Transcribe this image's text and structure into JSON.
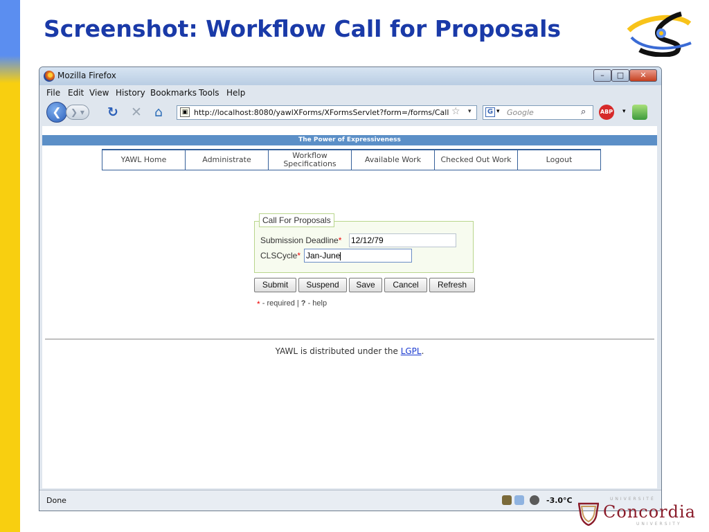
{
  "slide": {
    "title": "Screenshot: Workflow Call for Proposals"
  },
  "window": {
    "title": "Mozilla Firefox",
    "minimize": "–",
    "maximize": "□",
    "close": "✕"
  },
  "menu": [
    "File",
    "Edit",
    "View",
    "History",
    "Bookmarks",
    "Tools",
    "Help"
  ],
  "toolbar": {
    "url": "http://localhost:8080/yawlXForms/XFormsServlet?form=/forms/Call",
    "search_placeholder": "Google",
    "search_engine_letter": "G",
    "adblock_label": "ABP"
  },
  "page": {
    "banner": "The Power of Expressiveness",
    "nav": [
      {
        "label": "YAWL Home"
      },
      {
        "label": "Administrate"
      },
      {
        "label": "Workflow Specifications",
        "line1": "Workflow",
        "line2": "Specifications"
      },
      {
        "label": "Available Work"
      },
      {
        "label": "Checked Out Work"
      },
      {
        "label": "Logout"
      }
    ],
    "form": {
      "legend": "Call For Proposals",
      "fields": [
        {
          "label": "Submission Deadline",
          "required_mark": "*",
          "value": "12/12/79"
        },
        {
          "label": "CLSCycle",
          "required_mark": "*",
          "value": "Jan-June"
        }
      ],
      "buttons": [
        "Submit",
        "Suspend",
        "Save",
        "Cancel",
        "Refresh"
      ],
      "help": {
        "star": "*",
        "required_text": " - required | ",
        "question": "?",
        "help_text": " - help"
      }
    },
    "footer": {
      "prefix": "YAWL is distributed under the ",
      "link": "LGPL",
      "suffix": "."
    }
  },
  "status": {
    "text": "Done",
    "temperature": "-3.0°C"
  },
  "logo": {
    "top": "UNIVERSITÉ",
    "name": "Concordia",
    "bottom": "UNIVERSITY"
  },
  "colors": {
    "title": "#1a3aa8",
    "banner": "#5b8fc7",
    "nav_border": "#345f99",
    "required": "#e00000",
    "concordia": "#8a1c2a"
  }
}
